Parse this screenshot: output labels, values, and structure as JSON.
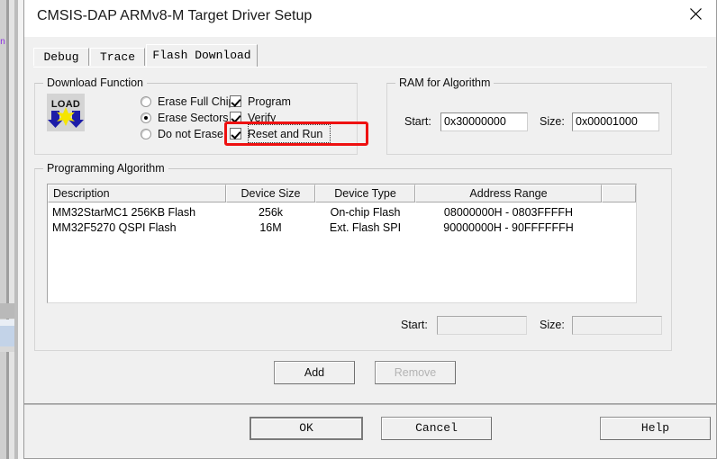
{
  "window": {
    "title": "CMSIS-DAP ARMv8-M Target Driver Setup",
    "close_icon": "close-icon"
  },
  "tabs": [
    {
      "label": "Debug",
      "active": false
    },
    {
      "label": "Trace",
      "active": false
    },
    {
      "label": "Flash Download",
      "active": true
    }
  ],
  "download_function": {
    "title": "Download Function",
    "icon_label": "LOAD",
    "erase_options": [
      {
        "label": "Erase Full Chip",
        "selected": false
      },
      {
        "label": "Erase Sectors",
        "selected": true
      },
      {
        "label": "Do not Erase",
        "selected": false
      }
    ],
    "checkboxes": [
      {
        "label": "Program",
        "checked": true,
        "focused": false
      },
      {
        "label": "Verify",
        "checked": true,
        "focused": false
      },
      {
        "label": "Reset and Run",
        "checked": true,
        "focused": true
      }
    ],
    "highlight_color": "#ee1111"
  },
  "ram_for_algorithm": {
    "title": "RAM for Algorithm",
    "start_label": "Start:",
    "start_value": "0x30000000",
    "size_label": "Size:",
    "size_value": "0x00001000"
  },
  "programming_algorithm": {
    "title": "Programming Algorithm",
    "columns": [
      "Description",
      "Device Size",
      "Device Type",
      "Address Range",
      ""
    ],
    "rows": [
      {
        "description": "MM32StarMC1 256KB Flash",
        "device_size": "256k",
        "device_type": "On-chip Flash",
        "address_range": "08000000H - 0803FFFFH"
      },
      {
        "description": "MM32F5270 QSPI Flash",
        "device_size": "16M",
        "device_type": "Ext. Flash SPI",
        "address_range": "90000000H - 90FFFFFFH"
      }
    ],
    "start_label": "Start:",
    "start_value": "",
    "size_label": "Size:",
    "size_value": "",
    "add_button": "Add",
    "remove_button": "Remove"
  },
  "footer": {
    "ok_button": "OK",
    "cancel_button": "Cancel",
    "help_button": "Help"
  },
  "background": {
    "glyph": "n"
  }
}
